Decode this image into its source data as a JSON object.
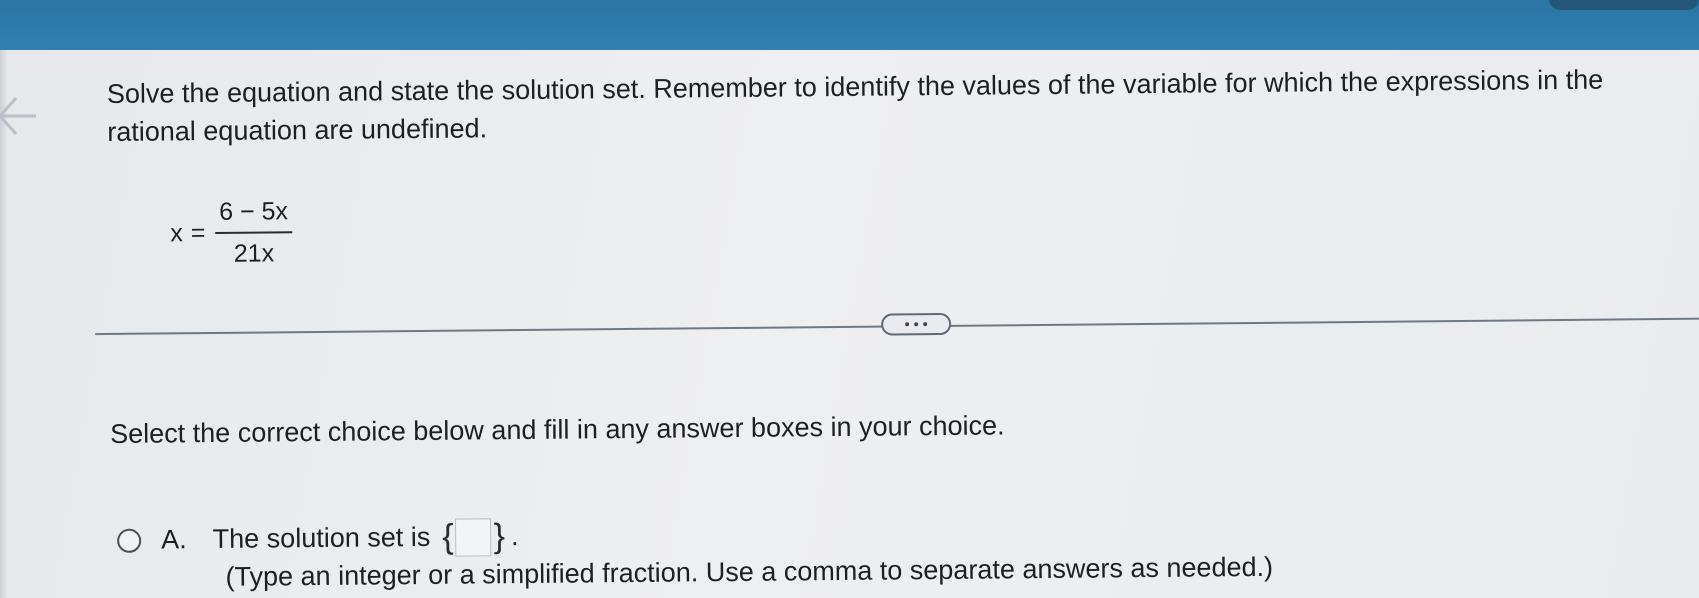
{
  "question": {
    "text": "Solve the equation and state the solution set. Remember to identify the values of the variable for which the expressions in the rational equation are undefined."
  },
  "equation": {
    "lhs": "x",
    "equals": "=",
    "numerator": "6 − 5x",
    "denominator": "21x"
  },
  "instruction": "Select the correct choice below and fill in any answer boxes in your choice.",
  "choices": [
    {
      "letter": "A.",
      "text": "The solution set is",
      "open_brace": "{",
      "close_brace": "}",
      "period": ".",
      "hint": "(Type an integer or a simplified fraction. Use a comma to separate answers as needed.)"
    }
  ],
  "colors": {
    "top_bar": "#2f80b0",
    "background": "#eceef0",
    "text": "#1d1f22"
  },
  "icons": {
    "back": "back-arrow-icon",
    "more": "ellipsis-icon"
  }
}
